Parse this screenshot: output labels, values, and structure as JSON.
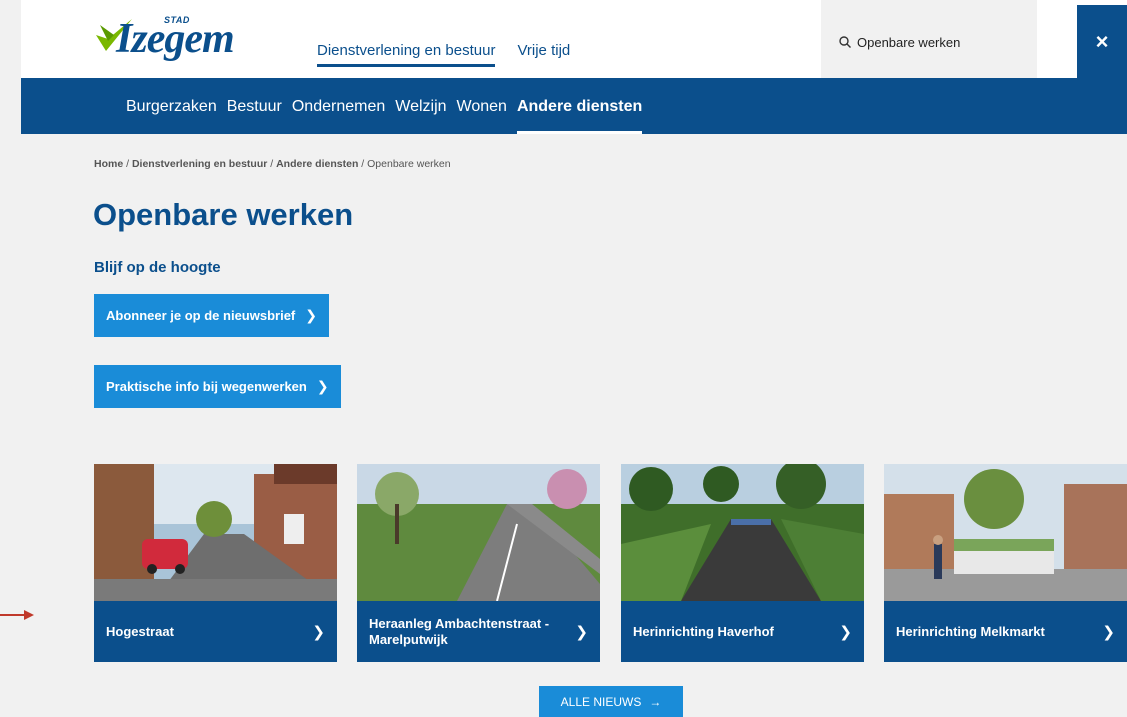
{
  "header": {
    "logo_stad": "STAD",
    "logo_name": "Izegem",
    "top_nav": [
      {
        "label": "Dienstverlening en bestuur",
        "active": true
      },
      {
        "label": "Vrije tijd",
        "active": false
      }
    ],
    "search_value": "Openbare werken",
    "close_icon": "×"
  },
  "main_nav": [
    {
      "label": "Burgerzaken"
    },
    {
      "label": "Bestuur"
    },
    {
      "label": "Ondernemen"
    },
    {
      "label": "Welzijn"
    },
    {
      "label": "Wonen"
    },
    {
      "label": "Andere diensten",
      "active": true
    }
  ],
  "breadcrumb": {
    "items": [
      "Home",
      "Dienstverlening en bestuur",
      "Andere diensten",
      "Openbare werken"
    ],
    "separator": " / "
  },
  "page": {
    "title": "Openbare werken",
    "subtitle": "Blijf op de hoogte",
    "buttons": [
      {
        "label": "Abonneer je op de nieuwsbrief"
      },
      {
        "label": "Praktische info bij wegenwerken"
      }
    ]
  },
  "cards": [
    {
      "title": "Hogestraat"
    },
    {
      "title": "Heraanleg Ambachtenstraat - Marelputwijk"
    },
    {
      "title": "Herinrichting Haverhof"
    },
    {
      "title": "Herinrichting Melkmarkt"
    }
  ],
  "all_news": {
    "label": "ALLE NIEUWS"
  },
  "colors": {
    "brand_blue": "#0b4f8c",
    "accent_blue": "#1a8cd8",
    "arrow_red": "#c0392b"
  }
}
